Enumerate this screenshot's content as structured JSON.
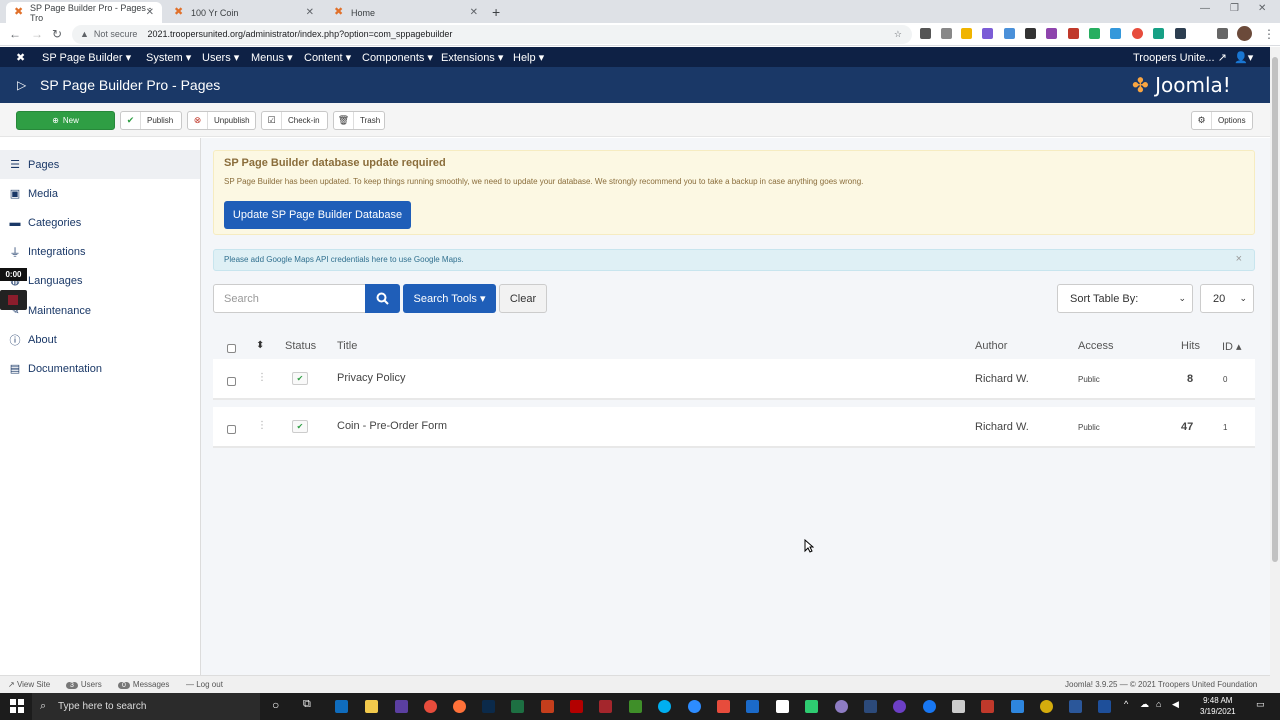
{
  "browser": {
    "tabs": [
      {
        "title": "SP Page Builder Pro - Pages - Tro",
        "active": true
      },
      {
        "title": "100 Yr Coin",
        "active": false
      },
      {
        "title": "Home",
        "active": false
      }
    ],
    "url_warning": "Not secure",
    "url": "2021.troopersunited.org/administrator/index.php?option=com_sppagebuilder"
  },
  "topnav": {
    "items": [
      "SP Page Builder",
      "System",
      "Users",
      "Menus",
      "Content",
      "Components",
      "Extensions",
      "Help"
    ],
    "site_link": "Troopers Unite..."
  },
  "header": {
    "title": "SP Page Builder Pro - Pages",
    "logo_text": "Joomla!"
  },
  "toolbar": {
    "new_label": "New",
    "publish_label": "Publish",
    "unpublish_label": "Unpublish",
    "checkin_label": "Check-in",
    "trash_label": "Trash",
    "options_label": "Options"
  },
  "sidebar": {
    "items": [
      {
        "label": "Pages",
        "icon": "list-icon",
        "active": true
      },
      {
        "label": "Media",
        "icon": "image-icon",
        "active": false
      },
      {
        "label": "Categories",
        "icon": "folder-icon",
        "active": false
      },
      {
        "label": "Integrations",
        "icon": "plug-icon",
        "active": false
      },
      {
        "label": "Languages",
        "icon": "globe-icon",
        "active": false
      },
      {
        "label": "Maintenance",
        "icon": "wrench-icon",
        "active": false
      },
      {
        "label": "About",
        "icon": "info-icon",
        "active": false
      },
      {
        "label": "Documentation",
        "icon": "book-icon",
        "active": false
      }
    ]
  },
  "video_overlay": {
    "time": "0:00"
  },
  "alerts": {
    "update_title": "SP Page Builder database update required",
    "update_text": "SP Page Builder has been updated. To keep things running smoothly, we need to update your database. We strongly recommend you to take a backup in case anything goes wrong.",
    "update_button": "Update SP Page Builder Database",
    "maps_text": "Please add Google Maps API credentials here to use Google Maps.",
    "close_symbol": "×"
  },
  "filters": {
    "search_placeholder": "Search",
    "search_tools_label": "Search Tools ▾",
    "clear_label": "Clear",
    "sort_label": "Sort Table By:",
    "limit_value": "20"
  },
  "table": {
    "headers": {
      "status": "Status",
      "title": "Title",
      "author": "Author",
      "access": "Access",
      "hits": "Hits",
      "id": "ID ▴"
    },
    "rows": [
      {
        "title": "Privacy Policy",
        "author": "Richard W.",
        "access": "Public",
        "hits": "8",
        "id": "0"
      },
      {
        "title": "Coin - Pre-Order Form",
        "author": "Richard W.",
        "access": "Public",
        "hits": "47",
        "id": "1"
      }
    ]
  },
  "footer": {
    "view_site": "View Site",
    "users_count": "3",
    "users_label": "Users",
    "messages_count": "0",
    "messages_label": "Messages",
    "logout": "Log out",
    "copyright": "Joomla! 3.9.25  —  © 2021 Troopers United Foundation"
  },
  "taskbar": {
    "search_placeholder": "Type here to search",
    "time": "9:48 AM",
    "date": "3/19/2021"
  }
}
